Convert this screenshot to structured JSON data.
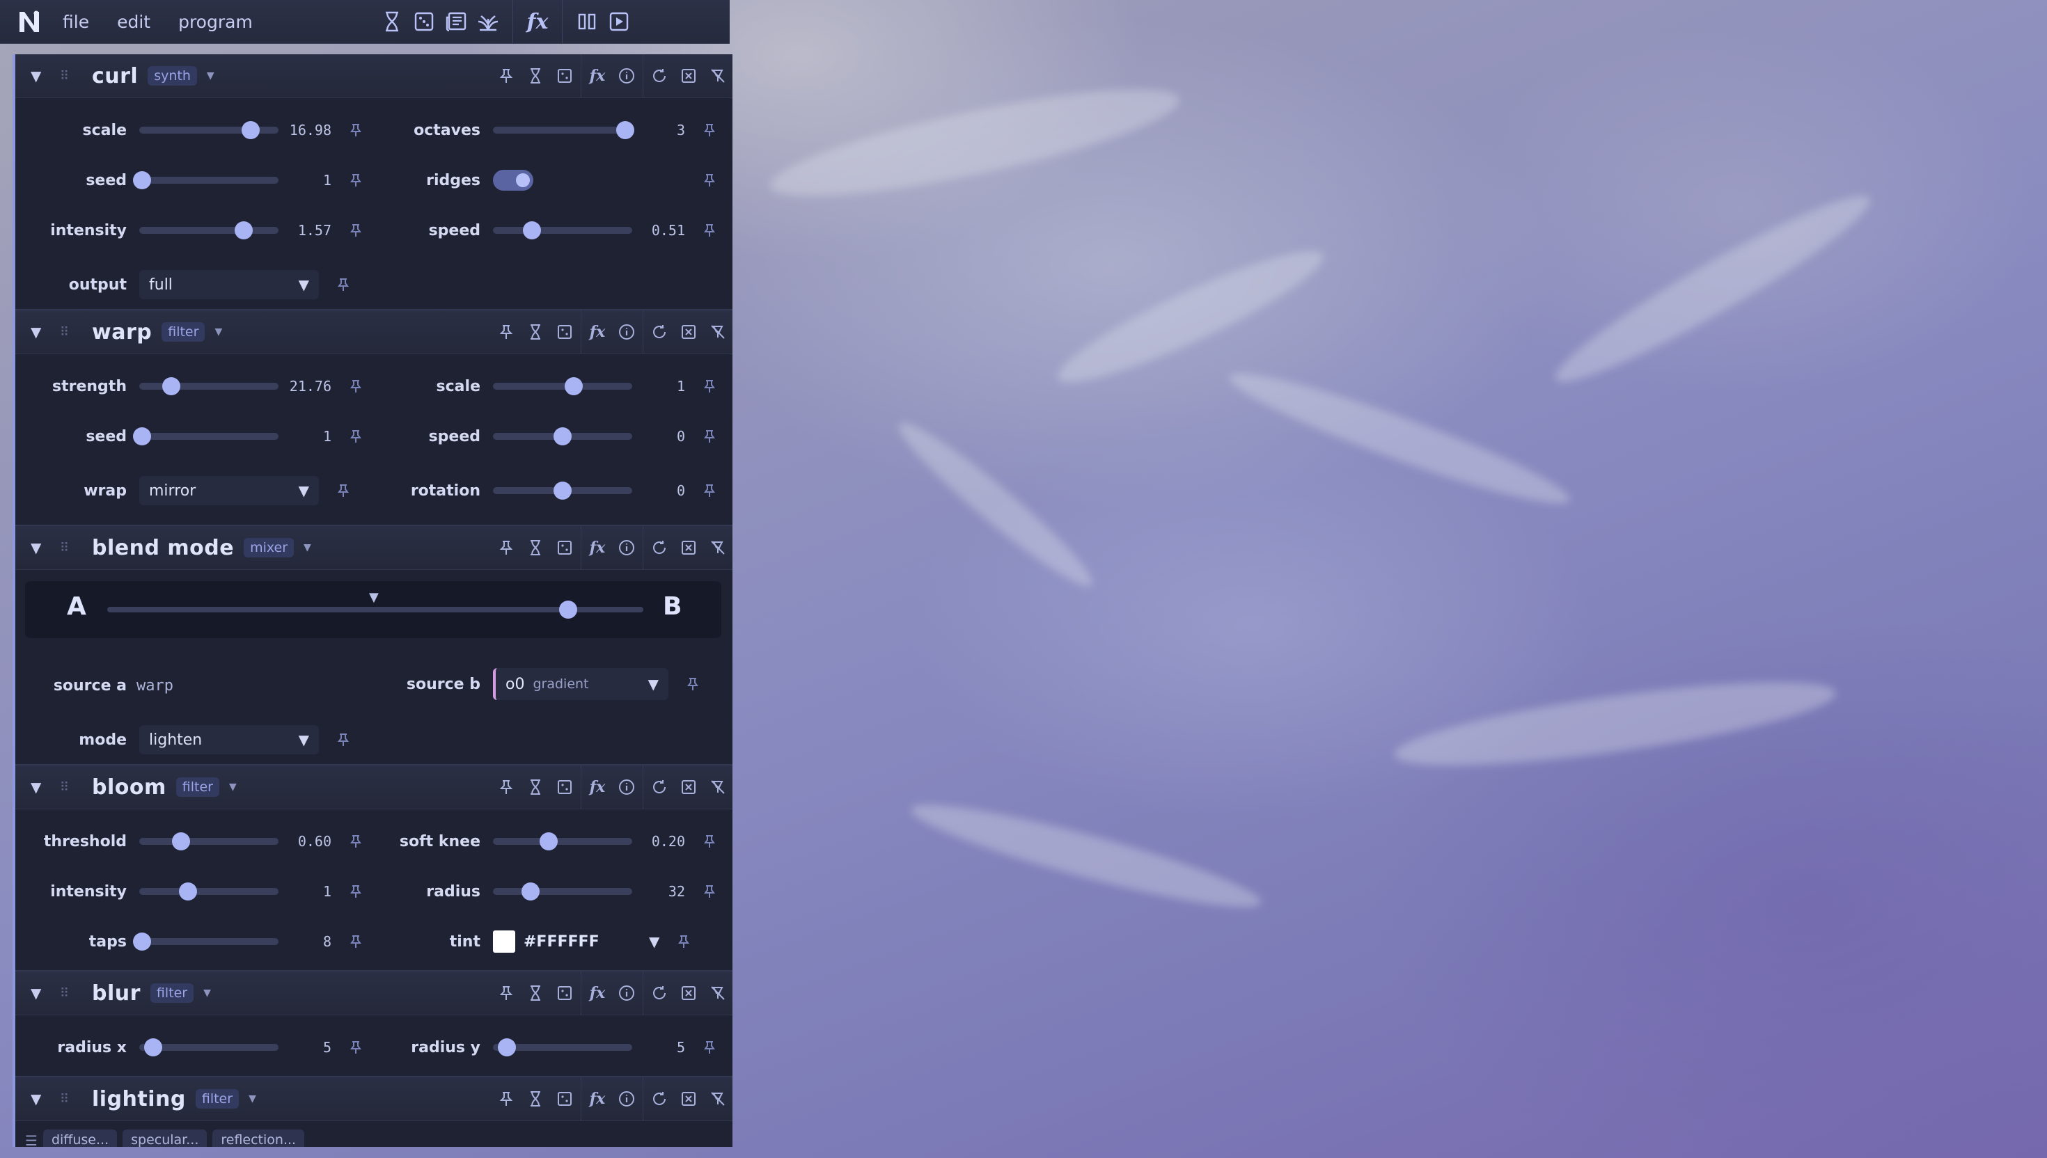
{
  "menubar": {
    "items": [
      "file",
      "edit",
      "program"
    ]
  },
  "toolbar_icons": [
    "dna-icon",
    "dice-icon",
    "news-icon",
    "plant-icon",
    "function-icon",
    "columns-icon",
    "play-icon"
  ],
  "modules": {
    "curl": {
      "title": "curl",
      "tag": "synth",
      "params": {
        "scale": {
          "label": "scale",
          "value": "16.98",
          "level": 0.8
        },
        "octaves": {
          "label": "octaves",
          "value": "3",
          "level": 0.95
        },
        "seed": {
          "label": "seed",
          "value": "1",
          "level": 0.02
        },
        "ridges": {
          "label": "ridges",
          "on": true
        },
        "intensity": {
          "label": "intensity",
          "value": "1.57",
          "level": 0.75
        },
        "speed": {
          "label": "speed",
          "value": "0.51",
          "level": 0.28
        },
        "output": {
          "label": "output",
          "value": "full"
        }
      }
    },
    "warp": {
      "title": "warp",
      "tag": "filter",
      "params": {
        "strength": {
          "label": "strength",
          "value": "21.76",
          "level": 0.23
        },
        "scale": {
          "label": "scale",
          "value": "1",
          "level": 0.58
        },
        "seed": {
          "label": "seed",
          "value": "1",
          "level": 0.02
        },
        "speed": {
          "label": "speed",
          "value": "0",
          "level": 0.5
        },
        "wrap": {
          "label": "wrap",
          "value": "mirror"
        },
        "rotation": {
          "label": "rotation",
          "value": "0",
          "level": 0.5
        }
      }
    },
    "blend": {
      "title": "blend mode",
      "tag": "mixer",
      "ab": {
        "a": "A",
        "b": "B",
        "level": 0.86,
        "marker": 0.5
      },
      "params": {
        "source_a": {
          "label": "source a",
          "value": "warp"
        },
        "source_b": {
          "label": "source b",
          "value": "o0",
          "sub": "gradient"
        },
        "mode": {
          "label": "mode",
          "value": "lighten"
        }
      }
    },
    "bloom": {
      "title": "bloom",
      "tag": "filter",
      "params": {
        "threshold": {
          "label": "threshold",
          "value": "0.60",
          "level": 0.3
        },
        "soft_knee": {
          "label": "soft knee",
          "value": "0.20",
          "level": 0.4
        },
        "intensity": {
          "label": "intensity",
          "value": "1",
          "level": 0.35
        },
        "radius": {
          "label": "radius",
          "value": "32",
          "level": 0.27
        },
        "taps": {
          "label": "taps",
          "value": "8",
          "level": 0.02
        },
        "tint": {
          "label": "tint",
          "value": "#FFFFFF",
          "color": "#ffffff"
        }
      }
    },
    "blur": {
      "title": "blur",
      "tag": "filter",
      "params": {
        "radius_x": {
          "label": "radius x",
          "value": "5",
          "level": 0.1
        },
        "radius_y": {
          "label": "radius y",
          "value": "5",
          "level": 0.1
        }
      }
    },
    "lighting": {
      "title": "lighting",
      "tag": "filter",
      "tabs": [
        "diffuse...",
        "specular...",
        "reflection..."
      ]
    }
  },
  "colors": {
    "accent": "#a9b4f5",
    "panel": "#1e2233",
    "tag_bg": "#323a60"
  }
}
